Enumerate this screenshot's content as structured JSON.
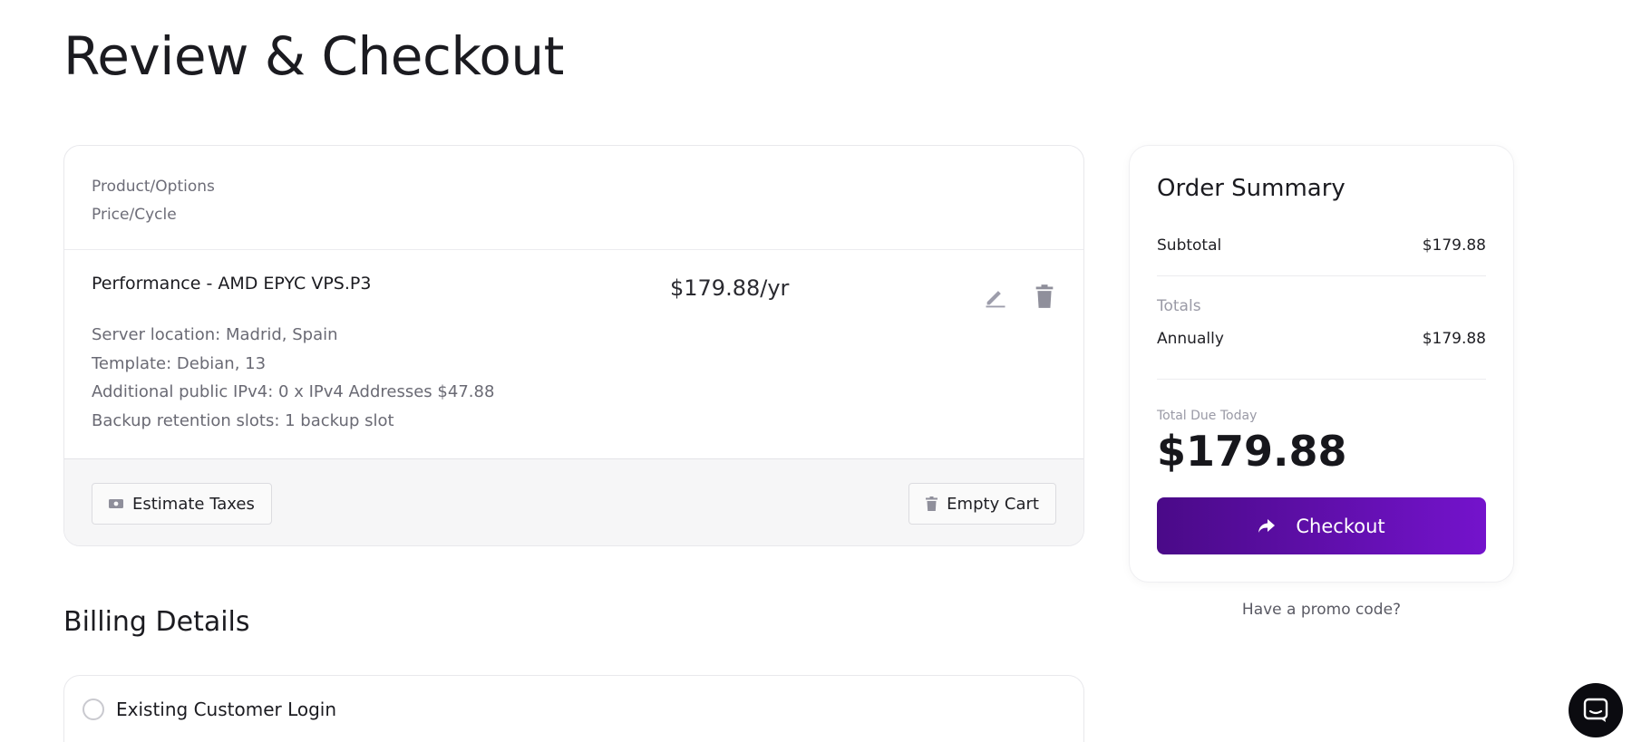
{
  "page": {
    "title": "Review & Checkout"
  },
  "cart": {
    "headers": [
      "Product/Options",
      "Price/Cycle"
    ],
    "item": {
      "name": "Performance - AMD EPYC VPS.P3",
      "price": "$179.88/yr",
      "options": [
        "Server location: Madrid, Spain",
        "Template: Debian, 13",
        "Additional public IPv4: 0 x IPv4 Addresses $47.88",
        "Backup retention slots: 1 backup slot"
      ],
      "edit_icon": "pencil-icon",
      "delete_icon": "trash-icon"
    },
    "estimate_taxes_label": "Estimate Taxes",
    "empty_cart_label": "Empty Cart"
  },
  "billing": {
    "title": "Billing Details",
    "existing_login_label": "Existing Customer Login"
  },
  "summary": {
    "title": "Order Summary",
    "subtotal_label": "Subtotal",
    "subtotal_value": "$179.88",
    "totals_label": "Totals",
    "annually_label": "Annually",
    "annually_value": "$179.88",
    "due_label": "Total Due Today",
    "due_value": "$179.88",
    "checkout_label": "Checkout",
    "promo_label": "Have a promo code?"
  },
  "colors": {
    "accent_start": "#4a0a88",
    "accent_end": "#7413cc"
  }
}
